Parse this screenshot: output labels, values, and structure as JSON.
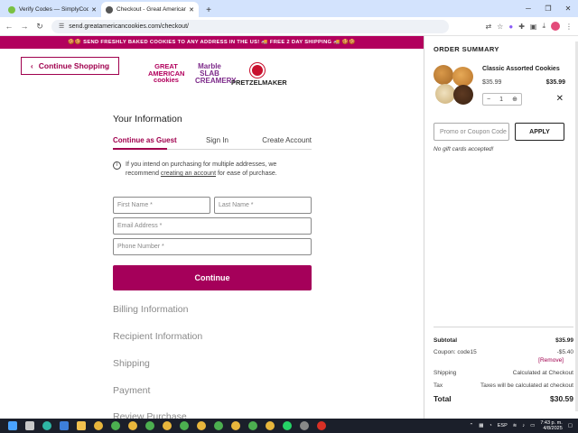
{
  "browser": {
    "tabs": [
      {
        "title": "Verify Codes — SimplyCodes",
        "active": false,
        "favicon_color": "#7ac143"
      },
      {
        "title": "Checkout - Great American Cookies",
        "active": true,
        "favicon_color": "#555555"
      }
    ],
    "url": "send.greatamericancookies.com/checkout/"
  },
  "banner": {
    "text": "🍪🍪 SEND FRESHLY BAKED COOKIES TO ANY ADDRESS IN THE US! 🚚 FREE 2 DAY SHIPPING 🚚 🍪🍪"
  },
  "header": {
    "continue_shopping": "Continue Shopping",
    "logos": {
      "gac": "GREAT AMERICAN cookies",
      "marble_slab": "Marble SLAB CREAMERY",
      "pretzelmaker": "PRETZELMAKER"
    }
  },
  "checkout": {
    "title": "Your Information",
    "tabs": [
      "Continue as Guest",
      "Sign In",
      "Create Account"
    ],
    "info_prefix": "If you intend on purchasing for multiple addresses, we recommend",
    "info_link": "creating an account",
    "info_suffix": "for ease of purchase.",
    "fields": {
      "first_name": "First Name *",
      "last_name": "Last Name *",
      "email": "Email Address *",
      "phone": "Phone Number *"
    },
    "continue_label": "Continue",
    "steps": [
      "Billing Information",
      "Recipient Information",
      "Shipping",
      "Payment",
      "Review Purchase"
    ]
  },
  "order_summary": {
    "title": "ORDER SUMMARY",
    "product": {
      "name": "Classic Assorted Cookies",
      "price": "$35.99",
      "total": "$35.99",
      "quantity": "1"
    },
    "promo_placeholder": "Promo or Coupon Code",
    "apply_label": "APPLY",
    "no_gift": "No gift cards accepted!",
    "subtotal_label": "Subtotal",
    "subtotal_value": "$35.99",
    "coupon_label": "Coupon: code15",
    "coupon_value": "-$5.40",
    "remove_label": "[Remove]",
    "shipping_label": "Shipping",
    "shipping_value": "Calculated at Checkout",
    "tax_label": "Tax",
    "tax_value": "Taxes will be calculated at checkout",
    "total_label": "Total",
    "total_value": "$30.59"
  },
  "taskbar": {
    "lang": "ESP",
    "time": "7:43 p. m.",
    "date": "4/8/2025"
  },
  "colors": {
    "brand": "#a5005a",
    "banner": "#b2005d"
  }
}
